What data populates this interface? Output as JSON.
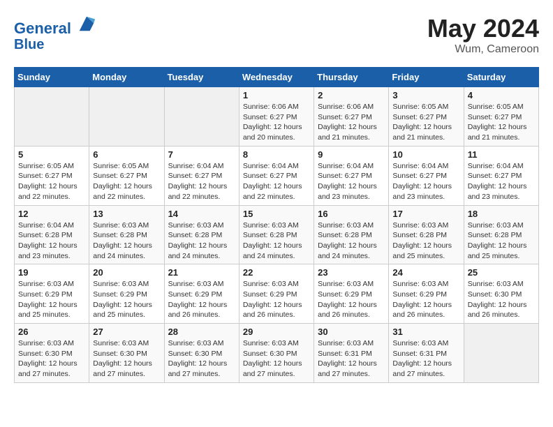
{
  "header": {
    "logo_line1": "General",
    "logo_line2": "Blue",
    "month": "May 2024",
    "location": "Wum, Cameroon"
  },
  "days_of_week": [
    "Sunday",
    "Monday",
    "Tuesday",
    "Wednesday",
    "Thursday",
    "Friday",
    "Saturday"
  ],
  "weeks": [
    [
      {
        "day": "",
        "info": ""
      },
      {
        "day": "",
        "info": ""
      },
      {
        "day": "",
        "info": ""
      },
      {
        "day": "1",
        "info": "Sunrise: 6:06 AM\nSunset: 6:27 PM\nDaylight: 12 hours\nand 20 minutes."
      },
      {
        "day": "2",
        "info": "Sunrise: 6:06 AM\nSunset: 6:27 PM\nDaylight: 12 hours\nand 21 minutes."
      },
      {
        "day": "3",
        "info": "Sunrise: 6:05 AM\nSunset: 6:27 PM\nDaylight: 12 hours\nand 21 minutes."
      },
      {
        "day": "4",
        "info": "Sunrise: 6:05 AM\nSunset: 6:27 PM\nDaylight: 12 hours\nand 21 minutes."
      }
    ],
    [
      {
        "day": "5",
        "info": "Sunrise: 6:05 AM\nSunset: 6:27 PM\nDaylight: 12 hours\nand 22 minutes."
      },
      {
        "day": "6",
        "info": "Sunrise: 6:05 AM\nSunset: 6:27 PM\nDaylight: 12 hours\nand 22 minutes."
      },
      {
        "day": "7",
        "info": "Sunrise: 6:04 AM\nSunset: 6:27 PM\nDaylight: 12 hours\nand 22 minutes."
      },
      {
        "day": "8",
        "info": "Sunrise: 6:04 AM\nSunset: 6:27 PM\nDaylight: 12 hours\nand 22 minutes."
      },
      {
        "day": "9",
        "info": "Sunrise: 6:04 AM\nSunset: 6:27 PM\nDaylight: 12 hours\nand 23 minutes."
      },
      {
        "day": "10",
        "info": "Sunrise: 6:04 AM\nSunset: 6:27 PM\nDaylight: 12 hours\nand 23 minutes."
      },
      {
        "day": "11",
        "info": "Sunrise: 6:04 AM\nSunset: 6:27 PM\nDaylight: 12 hours\nand 23 minutes."
      }
    ],
    [
      {
        "day": "12",
        "info": "Sunrise: 6:04 AM\nSunset: 6:28 PM\nDaylight: 12 hours\nand 23 minutes."
      },
      {
        "day": "13",
        "info": "Sunrise: 6:03 AM\nSunset: 6:28 PM\nDaylight: 12 hours\nand 24 minutes."
      },
      {
        "day": "14",
        "info": "Sunrise: 6:03 AM\nSunset: 6:28 PM\nDaylight: 12 hours\nand 24 minutes."
      },
      {
        "day": "15",
        "info": "Sunrise: 6:03 AM\nSunset: 6:28 PM\nDaylight: 12 hours\nand 24 minutes."
      },
      {
        "day": "16",
        "info": "Sunrise: 6:03 AM\nSunset: 6:28 PM\nDaylight: 12 hours\nand 24 minutes."
      },
      {
        "day": "17",
        "info": "Sunrise: 6:03 AM\nSunset: 6:28 PM\nDaylight: 12 hours\nand 25 minutes."
      },
      {
        "day": "18",
        "info": "Sunrise: 6:03 AM\nSunset: 6:28 PM\nDaylight: 12 hours\nand 25 minutes."
      }
    ],
    [
      {
        "day": "19",
        "info": "Sunrise: 6:03 AM\nSunset: 6:29 PM\nDaylight: 12 hours\nand 25 minutes."
      },
      {
        "day": "20",
        "info": "Sunrise: 6:03 AM\nSunset: 6:29 PM\nDaylight: 12 hours\nand 25 minutes."
      },
      {
        "day": "21",
        "info": "Sunrise: 6:03 AM\nSunset: 6:29 PM\nDaylight: 12 hours\nand 26 minutes."
      },
      {
        "day": "22",
        "info": "Sunrise: 6:03 AM\nSunset: 6:29 PM\nDaylight: 12 hours\nand 26 minutes."
      },
      {
        "day": "23",
        "info": "Sunrise: 6:03 AM\nSunset: 6:29 PM\nDaylight: 12 hours\nand 26 minutes."
      },
      {
        "day": "24",
        "info": "Sunrise: 6:03 AM\nSunset: 6:29 PM\nDaylight: 12 hours\nand 26 minutes."
      },
      {
        "day": "25",
        "info": "Sunrise: 6:03 AM\nSunset: 6:30 PM\nDaylight: 12 hours\nand 26 minutes."
      }
    ],
    [
      {
        "day": "26",
        "info": "Sunrise: 6:03 AM\nSunset: 6:30 PM\nDaylight: 12 hours\nand 27 minutes."
      },
      {
        "day": "27",
        "info": "Sunrise: 6:03 AM\nSunset: 6:30 PM\nDaylight: 12 hours\nand 27 minutes."
      },
      {
        "day": "28",
        "info": "Sunrise: 6:03 AM\nSunset: 6:30 PM\nDaylight: 12 hours\nand 27 minutes."
      },
      {
        "day": "29",
        "info": "Sunrise: 6:03 AM\nSunset: 6:30 PM\nDaylight: 12 hours\nand 27 minutes."
      },
      {
        "day": "30",
        "info": "Sunrise: 6:03 AM\nSunset: 6:31 PM\nDaylight: 12 hours\nand 27 minutes."
      },
      {
        "day": "31",
        "info": "Sunrise: 6:03 AM\nSunset: 6:31 PM\nDaylight: 12 hours\nand 27 minutes."
      },
      {
        "day": "",
        "info": ""
      }
    ]
  ]
}
